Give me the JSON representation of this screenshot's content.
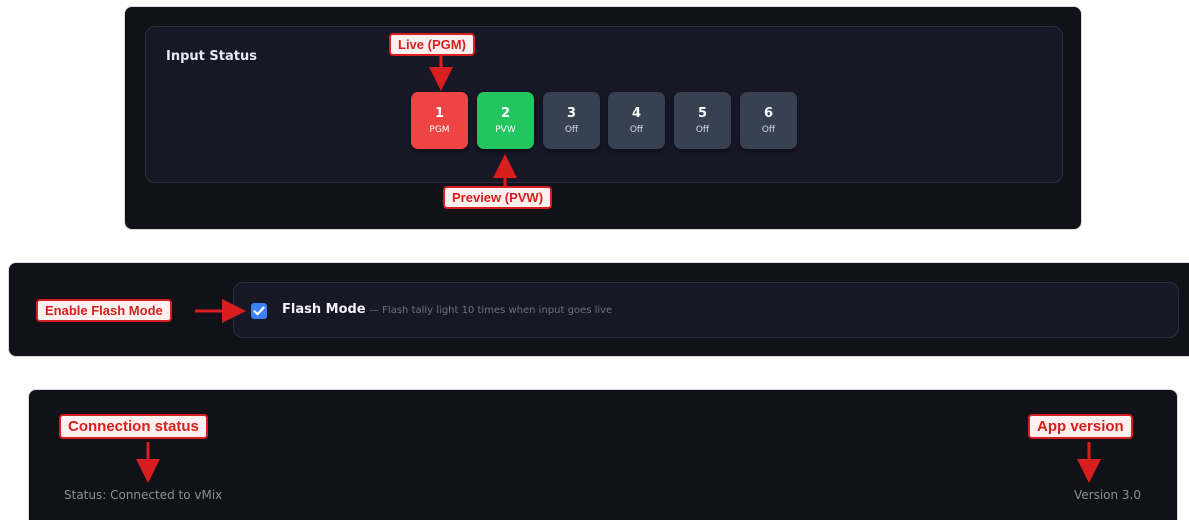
{
  "input_status": {
    "title": "Input Status",
    "inputs": [
      {
        "number": "1",
        "state": "PGM"
      },
      {
        "number": "2",
        "state": "PVW"
      },
      {
        "number": "3",
        "state": "Off"
      },
      {
        "number": "4",
        "state": "Off"
      },
      {
        "number": "5",
        "state": "Off"
      },
      {
        "number": "6",
        "state": "Off"
      }
    ]
  },
  "flash_mode": {
    "label": "Flash Mode",
    "description": "— Flash tally light 10 times when input goes live",
    "checked": true
  },
  "footer": {
    "status": "Status: Connected to vMix",
    "version": "Version 3.0"
  },
  "callouts": {
    "live": "Live (PGM)",
    "preview": "Preview (PVW)",
    "flash": "Enable Flash Mode",
    "connection": "Connection status",
    "version": "App version"
  },
  "colors": {
    "pgm": "#ef4444",
    "pvw": "#22c55e",
    "off": "#374151",
    "annotation": "#d81e1e",
    "checkbox": "#3b82f6"
  }
}
